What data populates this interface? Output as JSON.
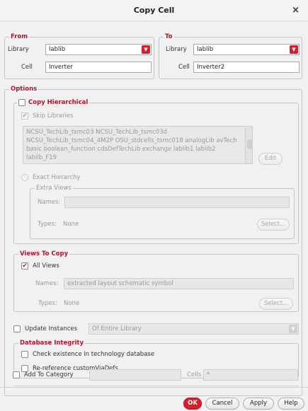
{
  "window": {
    "title": "Copy Cell",
    "close_glyph": "×"
  },
  "from": {
    "legend": "From",
    "library_label": "Library",
    "library_value": "lablib",
    "cell_label": "Cell",
    "cell_value": "Inverter"
  },
  "to": {
    "legend": "To",
    "library_label": "Library",
    "library_value": "lablib",
    "cell_label": "Cell",
    "cell_value": "Inverter2"
  },
  "options": {
    "legend": "Options",
    "copy_hierarchical": {
      "label": "Copy Hierarchical",
      "checked": false
    },
    "skip_libraries": {
      "label": "Skip Libraries",
      "checked": true,
      "enabled": false
    },
    "libraries_list": [
      "NCSU_TechLib_tsmc03 NCSU_TechLib_tsmc03d",
      "NCSU_TechLib_tsmc04_4M2P OSU_stdcells_tsmc018 analogLib avTech",
      "basic boolean_function cdsDefTechLib exchange lablib1 lablib2",
      "lablib_F19"
    ],
    "edit_button": "Edit",
    "exact_hierarchy": "Exact Hierarchy",
    "extra_views": {
      "legend": "Extra Views",
      "names_label": "Names:",
      "names_value": "",
      "types_label": "Types:",
      "types_value": "None",
      "select_button": "Select..."
    },
    "views_to_copy": {
      "legend": "Views To Copy",
      "all_views": {
        "label": "All Views",
        "checked": true
      },
      "names_label": "Names:",
      "names_value": "extracted layout schematic symbol",
      "types_label": "Types:",
      "types_value": "None",
      "select_button": "Select..."
    },
    "update_instances": {
      "label": "Update Instances",
      "checked": false,
      "scope": "Of Entire Library"
    },
    "database_integrity": {
      "legend": "Database Integrity",
      "check_existence": {
        "label": "Check existence in technology database",
        "checked": false
      },
      "rereference": {
        "label": "Re-reference customViaDefs",
        "checked": false
      }
    },
    "add_to_category": {
      "label": "Add To Category",
      "checked": false,
      "category_value": "",
      "cells_label": "Cells",
      "cells_value": "*"
    }
  },
  "buttons": {
    "ok": "OK",
    "cancel": "Cancel",
    "apply": "Apply",
    "help": "Help"
  },
  "colors": {
    "accent": "#d4202c",
    "legend_text": "#b5132b"
  }
}
